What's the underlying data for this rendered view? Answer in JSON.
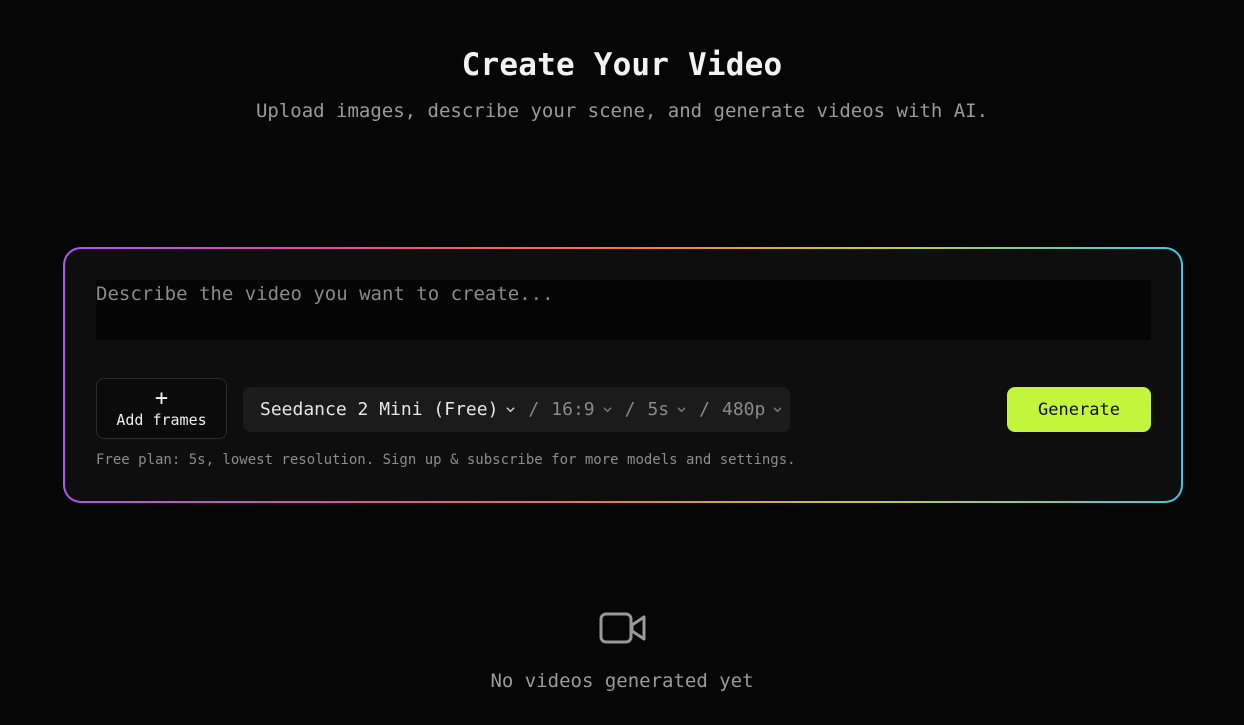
{
  "header": {
    "title": "Create Your Video",
    "subtitle": "Upload images, describe your scene, and generate videos with AI."
  },
  "composer": {
    "prompt_value": "",
    "prompt_placeholder": "Describe the video you want to create...",
    "add_frames_icon": "+",
    "add_frames_label": "Add frames",
    "settings": {
      "model": "Seedance 2 Mini (Free)",
      "aspect_ratio": "16:9",
      "duration": "5s",
      "resolution": "480p",
      "separator": "/"
    },
    "generate_label": "Generate",
    "plan_note": "Free plan: 5s, lowest resolution. Sign up & subscribe for more models and settings."
  },
  "empty_state": {
    "icon": "video-camera-icon",
    "text": "No videos generated yet"
  },
  "colors": {
    "accent": "#c3f53c",
    "background": "#060606",
    "gradient": [
      "#b055f0",
      "#e0509a",
      "#f07a3c",
      "#c8c83a",
      "#3cc8e8"
    ]
  }
}
